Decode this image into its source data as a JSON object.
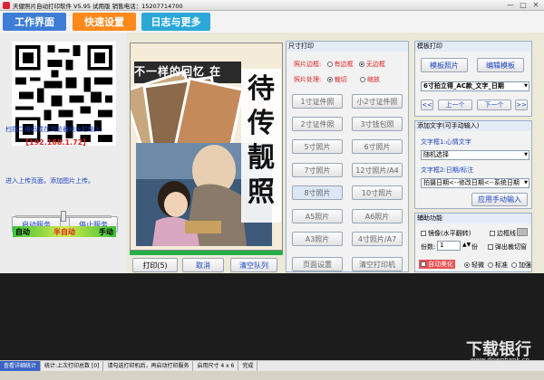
{
  "window": {
    "title": "天健照片自动打印软件 V5.95 试用版 销售电话：15207714700",
    "controls": [
      "—",
      "□",
      "✕"
    ]
  },
  "tabs": [
    {
      "label": "工作界面"
    },
    {
      "label": "快速设置"
    },
    {
      "label": "日志与更多"
    }
  ],
  "left": {
    "scan_text": "扫描二维码或在浏览器地址栏输入:",
    "ip": "【192.168.1.72】",
    "hint": "进入上传页面，添加图片上传。",
    "start_label": "启动服务",
    "stop_label": "停止服务",
    "modes": [
      "自动",
      "半自动",
      "手动"
    ],
    "mode_level": 0.5
  },
  "preview": {
    "caption": "不一样的回忆 在",
    "art_text": [
      "待",
      "传",
      "靓",
      "照"
    ],
    "progress": 1.0
  },
  "bottom_buttons": {
    "print": "打印(5)",
    "cancel": "取消",
    "clear": "清空队列"
  },
  "size_panel": {
    "title": "尺寸打印",
    "border_label": "照片边框:",
    "border_opt1": "有边框",
    "border_opt2": "无边框",
    "process_label": "照片处理:",
    "process_opt1": "裁切",
    "process_opt2": "缩放",
    "sizes": [
      "1寸证件照",
      "小2寸证件照",
      "2寸证件照",
      "3寸钱包照",
      "5寸照片",
      "6寸照片",
      "7寸照片",
      "12寸照片/A4",
      "8寸照片",
      "10寸照片",
      "A5照片",
      "A6照片",
      "A3照片",
      "4寸照片/A7"
    ],
    "page_setup": "页面设置",
    "clear_printer": "清空打印机"
  },
  "template_panel": {
    "title": "模板打印",
    "template_photo": "模板照片",
    "edit_template": "编辑模板",
    "template_select": "6寸拍立得_AC款_文字_日期",
    "nav_first": "<<",
    "nav_prev": "上一个",
    "nav_next": "下一个",
    "nav_last": ">>"
  },
  "text_panel": {
    "title": "添加文字(可手动输入)",
    "box1_label": "文字框1:心情文字",
    "box1_value": "随机选择",
    "box2_label": "文字框2:日期/标注",
    "box2_value": "拍摄日期<--修改日期<--系统日期",
    "apply": "应用手动输入"
  },
  "aux_panel": {
    "title": "辅助功能",
    "mirror": "镜像(水平翻转)",
    "frame_line": "边框线",
    "copies_label": "份数:",
    "copies_value": "1",
    "copies_unit": "份",
    "popup": "弹出裁切窗",
    "auto_beauty": "自动美化",
    "beauty_light": "轻微",
    "beauty_std": "标准",
    "beauty_strong": "加强"
  },
  "status": {
    "view_stats": "查看详细统计",
    "last_print": "统计:上次打印总数 [0]",
    "hint": "请勾选打印机后，再启动打印服务",
    "size": "启用尺寸 4 x 6",
    "done": "完成"
  },
  "watermark": {
    "brand": "下载银行",
    "url": "www.downbank.cn"
  },
  "colors": {
    "tab_work": "#3d7dd6",
    "tab_quick": "#ff8a1c",
    "tab_log": "#2ba8d8",
    "accent_text": "#1a44c4",
    "ip_red": "#dd2222",
    "progress": "#23b04a"
  }
}
